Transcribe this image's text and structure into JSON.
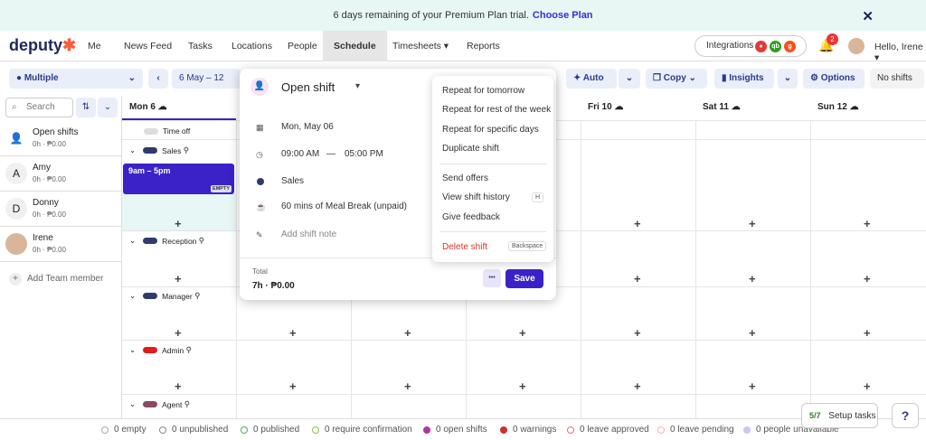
{
  "banner": {
    "text": "6 days remaining of your Premium Plan trial.",
    "link": "Choose Plan",
    "close": "✕"
  },
  "nav": {
    "logo": "deputy",
    "items": [
      "Me",
      "News Feed",
      "Tasks",
      "Locations",
      "People",
      "Schedule",
      "Timesheets ▾",
      "Reports"
    ],
    "integrations": "Integrations",
    "notif_count": "2",
    "hello": "Hello, Irene ▾"
  },
  "toolbar": {
    "location": "Multiple",
    "date_range": "6 May – 12",
    "auto": "Auto",
    "copy": "Copy",
    "insights": "Insights",
    "options": "Options",
    "no_shifts": "No shifts"
  },
  "sidebar": {
    "search_placeholder": "Search",
    "add_member": "Add Team member",
    "people": [
      {
        "initial": "",
        "name": "Open shifts",
        "hours": "0h · ₱0.00"
      },
      {
        "initial": "A",
        "name": "Amy",
        "hours": "0h · ₱0.00"
      },
      {
        "initial": "D",
        "name": "Donny",
        "hours": "0h · ₱0.00"
      },
      {
        "initial": "",
        "name": "Irene",
        "hours": "0h · ₱0.00"
      }
    ]
  },
  "days": [
    {
      "label": "Mon 6"
    },
    {
      "label": "Fri 10"
    },
    {
      "label": "Sat 11"
    },
    {
      "label": "Sun 12"
    }
  ],
  "groups": [
    "Time off",
    "Sales",
    "Reception",
    "Manager",
    "Admin",
    "Agent"
  ],
  "shift_block": {
    "time": "9am – 5pm",
    "badge": "EMPTY"
  },
  "modal": {
    "title": "Open shift",
    "date": "Mon, May 06",
    "start": "09:00 AM",
    "dash": "—",
    "end": "05:00 PM",
    "area": "Sales",
    "break": "60 mins of Meal Break (unpaid)",
    "note": "Add shift note",
    "total_label": "Total",
    "total": "7h · ₱0.00",
    "more": "•••",
    "save": "Save"
  },
  "menu": {
    "items": [
      "Repeat for tomorrow",
      "Repeat for rest of the week",
      "Repeat for specific days",
      "Duplicate shift",
      "Send offers",
      "View shift history",
      "Give feedback",
      "Delete shift"
    ],
    "history_key": "H",
    "delete_key": "Backspace"
  },
  "footer": [
    {
      "label": "0 empty",
      "color": "#aaaaaa"
    },
    {
      "label": "0 unpublished",
      "color": "#888888"
    },
    {
      "label": "0 published",
      "color": "#4caf50"
    },
    {
      "label": "0 require confirmation",
      "color": "#8bc34a"
    },
    {
      "label": "0 open shifts",
      "color": "#b0359a"
    },
    {
      "label": "0 warnings",
      "color": "#d32f2f"
    },
    {
      "label": "0 leave approved",
      "color": "#e57373"
    },
    {
      "label": "0 leave pending",
      "color": "#ffb3a7"
    },
    {
      "label": "0 people unavailable",
      "color": "#cfc6f0"
    }
  ],
  "setup": {
    "count": "5/7",
    "label": "Setup tasks"
  },
  "help": "?"
}
